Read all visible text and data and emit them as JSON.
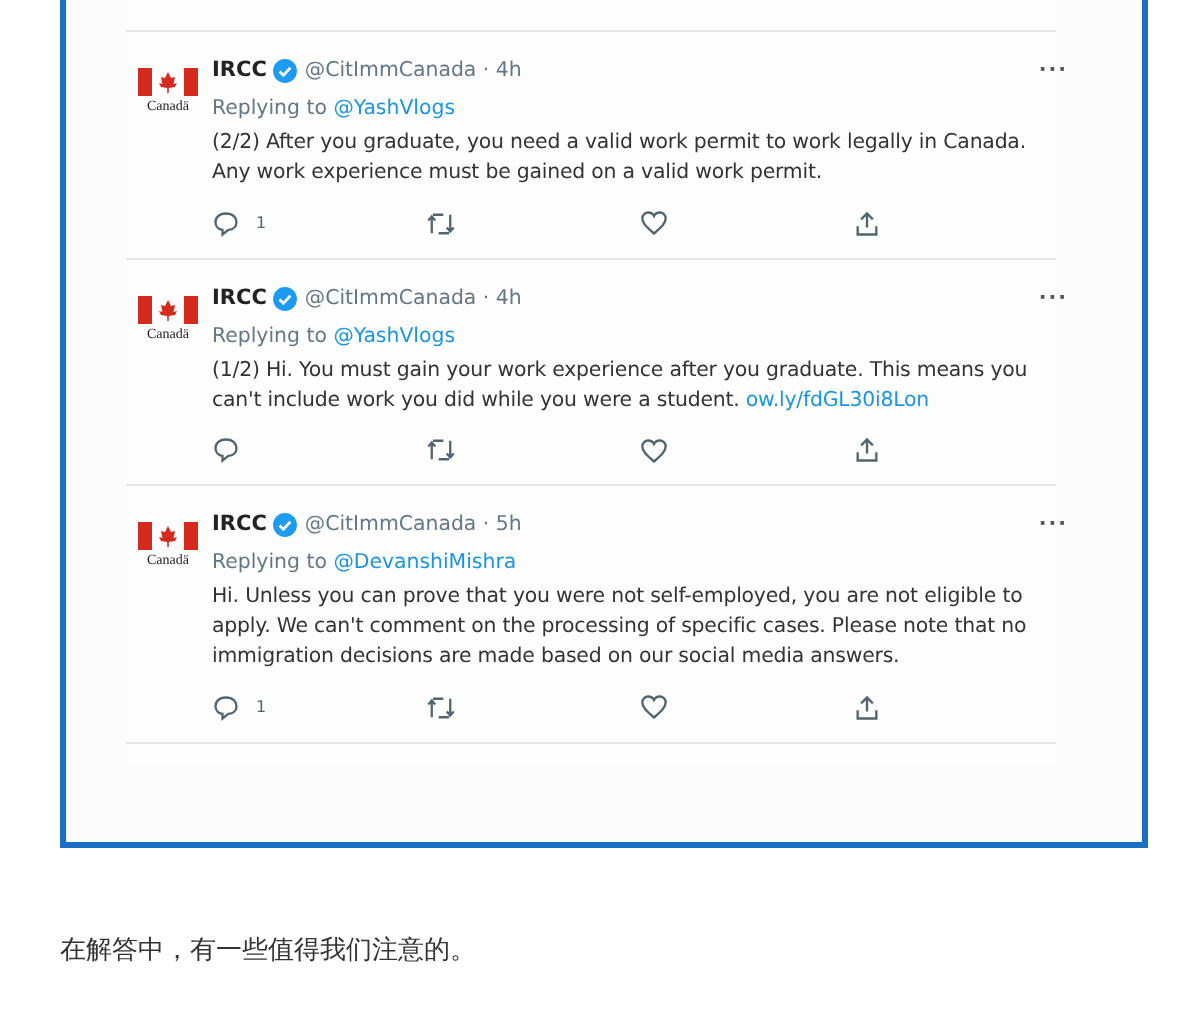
{
  "tweets": [
    {
      "logo_text": "Canadä",
      "name": "IRCC",
      "verified": true,
      "handle": "@CitImmCanada · 4h",
      "more": "···",
      "replying_label": "Replying to",
      "replying_to": "@YashVlogs",
      "text": "(2/2) After you graduate, you need a valid work permit to work legally in Canada. Any work experience must be gained on a valid work permit.",
      "reply_count": "1"
    },
    {
      "logo_text": "Canadä",
      "name": "IRCC",
      "verified": true,
      "handle": "@CitImmCanada · 4h",
      "more": "···",
      "replying_label": "Replying to",
      "replying_to": "@YashVlogs",
      "text": "(1/2) Hi. You must gain your work experience after you graduate. This means you can't include work you did while you were a student.",
      "link": "ow.ly/fdGL30i8Lon"
    },
    {
      "logo_text": "Canadä",
      "name": "IRCC",
      "verified": true,
      "handle": "@CitImmCanada · 5h",
      "more": "···",
      "replying_label": "Replying to",
      "replying_to": "@DevanshiMishra",
      "text": "Hi. Unless you can prove that you were not self-employed, you are not eligible to apply. We can't comment on the processing of specific cases. Please note that no immigration decisions are made based on our social media answers.",
      "reply_count": "1"
    }
  ],
  "caption": "在解答中，有一些值得我们注意的。"
}
